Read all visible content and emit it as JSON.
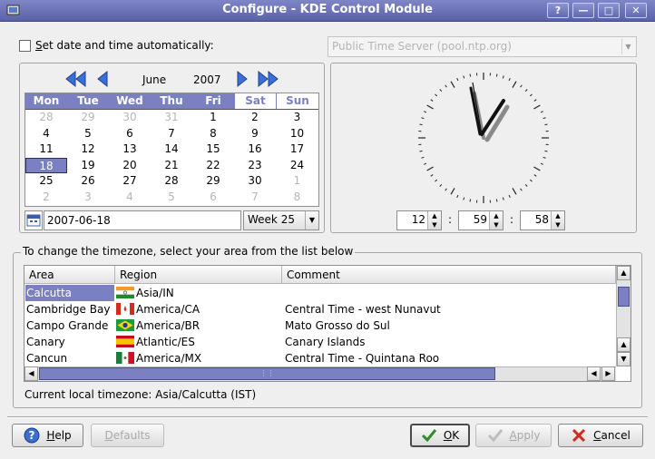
{
  "window": {
    "title": "Configure - KDE Control Module",
    "buttons": [
      "?",
      "—",
      "□",
      "✕"
    ]
  },
  "auto": {
    "label_prefix": "",
    "label_underlined": "S",
    "label_rest": "et date and time automatically:",
    "server_placeholder": "Public Time Server (pool.ntp.org)"
  },
  "calendar": {
    "month": "June",
    "year": "2007",
    "weekdays": [
      "Mon",
      "Tue",
      "Wed",
      "Thu",
      "Fri",
      "Sat",
      "Sun"
    ],
    "weeks": [
      [
        "28",
        "29",
        "30",
        "31",
        "1",
        "2",
        "3"
      ],
      [
        "4",
        "5",
        "6",
        "7",
        "8",
        "9",
        "10"
      ],
      [
        "11",
        "12",
        "13",
        "14",
        "15",
        "16",
        "17"
      ],
      [
        "18",
        "19",
        "20",
        "21",
        "22",
        "23",
        "24"
      ],
      [
        "25",
        "26",
        "27",
        "28",
        "29",
        "30",
        "1"
      ],
      [
        "2",
        "3",
        "4",
        "5",
        "6",
        "7",
        "8"
      ]
    ],
    "date_value": "2007-06-18",
    "week_label": "Week 25"
  },
  "clock": {
    "hour": "12",
    "minute": "59",
    "second": "58",
    "separator": ":"
  },
  "timezone": {
    "group_label": "To change the timezone, select your area from the list below",
    "columns": [
      "Area",
      "Region",
      "Comment"
    ],
    "rows": [
      {
        "area": "Calcutta",
        "region": "Asia/IN",
        "comment": "",
        "flag": "india",
        "selected": true
      },
      {
        "area": "Cambridge Bay",
        "region": "America/CA",
        "comment": "Central Time - west Nunavut",
        "flag": "canada",
        "selected": false
      },
      {
        "area": "Campo Grande",
        "region": "America/BR",
        "comment": "Mato Grosso do Sul",
        "flag": "brazil",
        "selected": false
      },
      {
        "area": "Canary",
        "region": "Atlantic/ES",
        "comment": "Canary Islands",
        "flag": "spain",
        "selected": false
      },
      {
        "area": "Cancun",
        "region": "America/MX",
        "comment": "Central Time - Quintana Roo",
        "flag": "mexico",
        "selected": false
      }
    ],
    "current_label": "Current local timezone: Asia/Calcutta (IST)"
  },
  "footer": {
    "help": {
      "label_u": "H",
      "label_rest": "elp"
    },
    "defaults": {
      "label_u": "D",
      "label_rest": "efaults"
    },
    "ok": {
      "label_u": "O",
      "label_rest": "K"
    },
    "apply": {
      "label_u": "A",
      "label_rest": "pply"
    },
    "cancel": {
      "label_u": "C",
      "label_rest": "ancel"
    }
  },
  "colors": {
    "accent": "#7b80c2",
    "titlebar": "#6169b0"
  }
}
